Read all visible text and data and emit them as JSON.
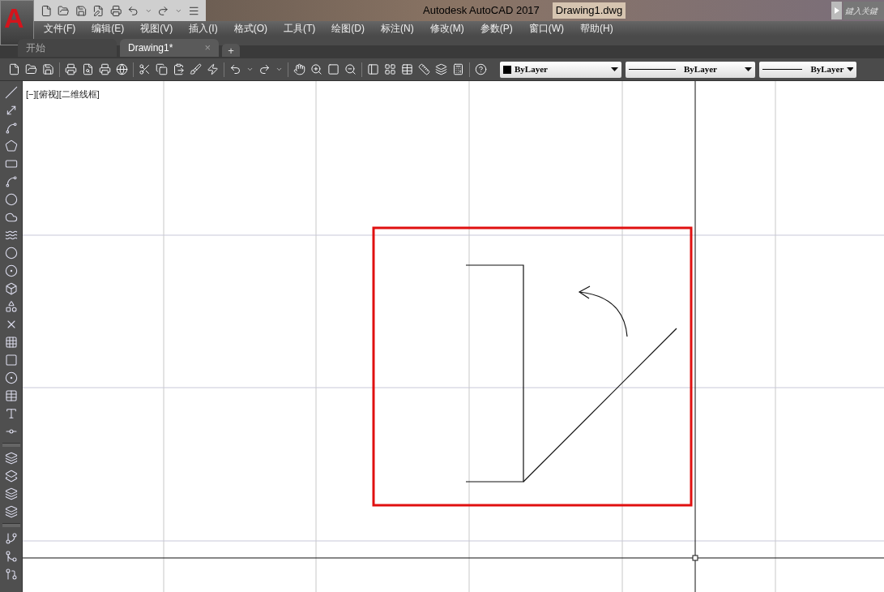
{
  "app_button": {
    "label": "A"
  },
  "window": {
    "title": "Autodesk AutoCAD 2017",
    "document": "Drawing1.dwg"
  },
  "search": {
    "placeholder": "鍵入关鍵"
  },
  "menu": [
    "文件(F)",
    "编辑(E)",
    "视图(V)",
    "插入(I)",
    "格式(O)",
    "工具(T)",
    "绘图(D)",
    "标注(N)",
    "修改(M)",
    "参数(P)",
    "窗口(W)",
    "帮助(H)"
  ],
  "tabs": [
    {
      "label": "开始",
      "selected": false
    },
    {
      "label": "Drawing1*",
      "selected": true,
      "close": "×"
    }
  ],
  "new_tab": {
    "label": "+"
  },
  "properties": [
    {
      "kind": "color",
      "value": "ByLayer"
    },
    {
      "kind": "linetype",
      "value": "ByLayer"
    },
    {
      "kind": "linetype",
      "value": "ByLayer"
    }
  ],
  "viewport_label": "[−][俯视][二维线框]"
}
